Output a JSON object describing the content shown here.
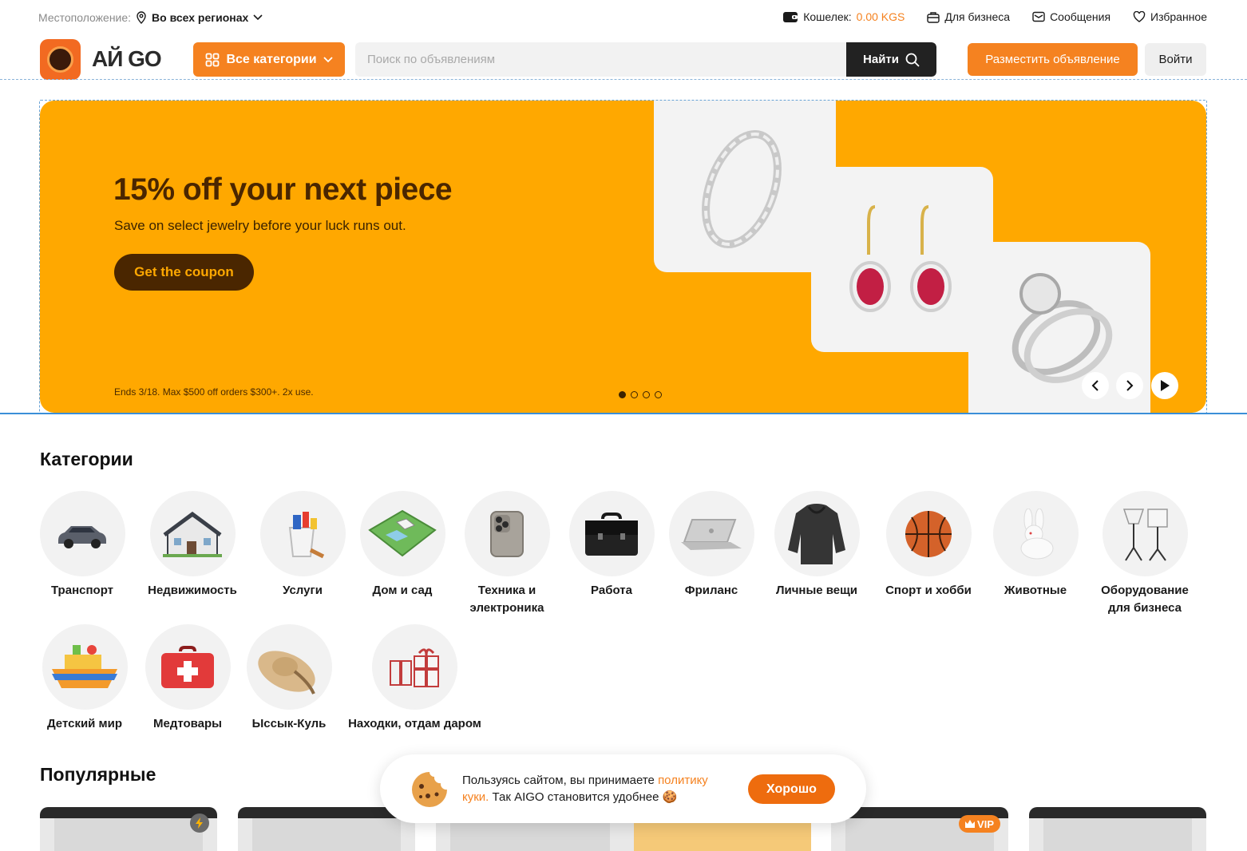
{
  "topbar": {
    "location_label": "Местоположение:",
    "location_value": "Во всех регионах",
    "wallet_label": "Кошелек:",
    "wallet_amount": "0.00 KGS",
    "business": "Для бизнеса",
    "messages": "Сообщения",
    "favorites": "Избранное"
  },
  "header": {
    "logo_text": "АЙ GO",
    "categories_button": "Все категории",
    "search_placeholder": "Поиск по объявлениям",
    "search_button": "Найти",
    "post_button": "Разместить объявление",
    "login_button": "Войти"
  },
  "banner": {
    "title": "15% off your next piece",
    "subtitle": "Save on select jewelry before your luck runs out.",
    "cta": "Get the coupon",
    "fine_print": "Ends 3/18. Max $500 off orders $300+. 2x use.",
    "slide_count": 4,
    "active_slide": 1,
    "background": "#ffa800"
  },
  "categories": {
    "title": "Категории",
    "items": [
      {
        "label": "Транспорт",
        "icon": "car-icon"
      },
      {
        "label": "Недвижимость",
        "icon": "house-icon"
      },
      {
        "label": "Услуги",
        "icon": "paint-bucket-icon"
      },
      {
        "label": "Дом и сад",
        "icon": "garden-icon"
      },
      {
        "label": "Техника и",
        "label2": "электроника",
        "icon": "phone-icon"
      },
      {
        "label": "Работа",
        "icon": "briefcase-icon"
      },
      {
        "label": "Фриланс",
        "icon": "laptop-icon"
      },
      {
        "label": "Личные вещи",
        "icon": "hoodie-icon"
      },
      {
        "label": "Спорт и хобби",
        "icon": "basketball-icon"
      },
      {
        "label": "Животные",
        "icon": "rabbit-icon"
      },
      {
        "label": "Оборудование",
        "label2": "для бизнеса",
        "icon": "studio-light-icon"
      },
      {
        "label": "Детский мир",
        "icon": "toy-boat-icon"
      },
      {
        "label": "Медтовары",
        "icon": "first-aid-kit-icon"
      },
      {
        "label": "Ыссык-Куль",
        "icon": "sun-hat-icon"
      },
      {
        "label": "Находки, отдам даром",
        "icon": "gift-icon"
      }
    ]
  },
  "popular": {
    "title": "Популярные",
    "vip_label": "VIP"
  },
  "cookie": {
    "text_before": "Пользуясь сайтом, вы принимаете ",
    "link": "политику куки.",
    "text_after": " Так AIGO становится удобнее 🍪",
    "button": "Хорошо"
  },
  "colors": {
    "accent": "#f58220",
    "banner": "#ffa800",
    "banner_text": "#4a2600"
  }
}
